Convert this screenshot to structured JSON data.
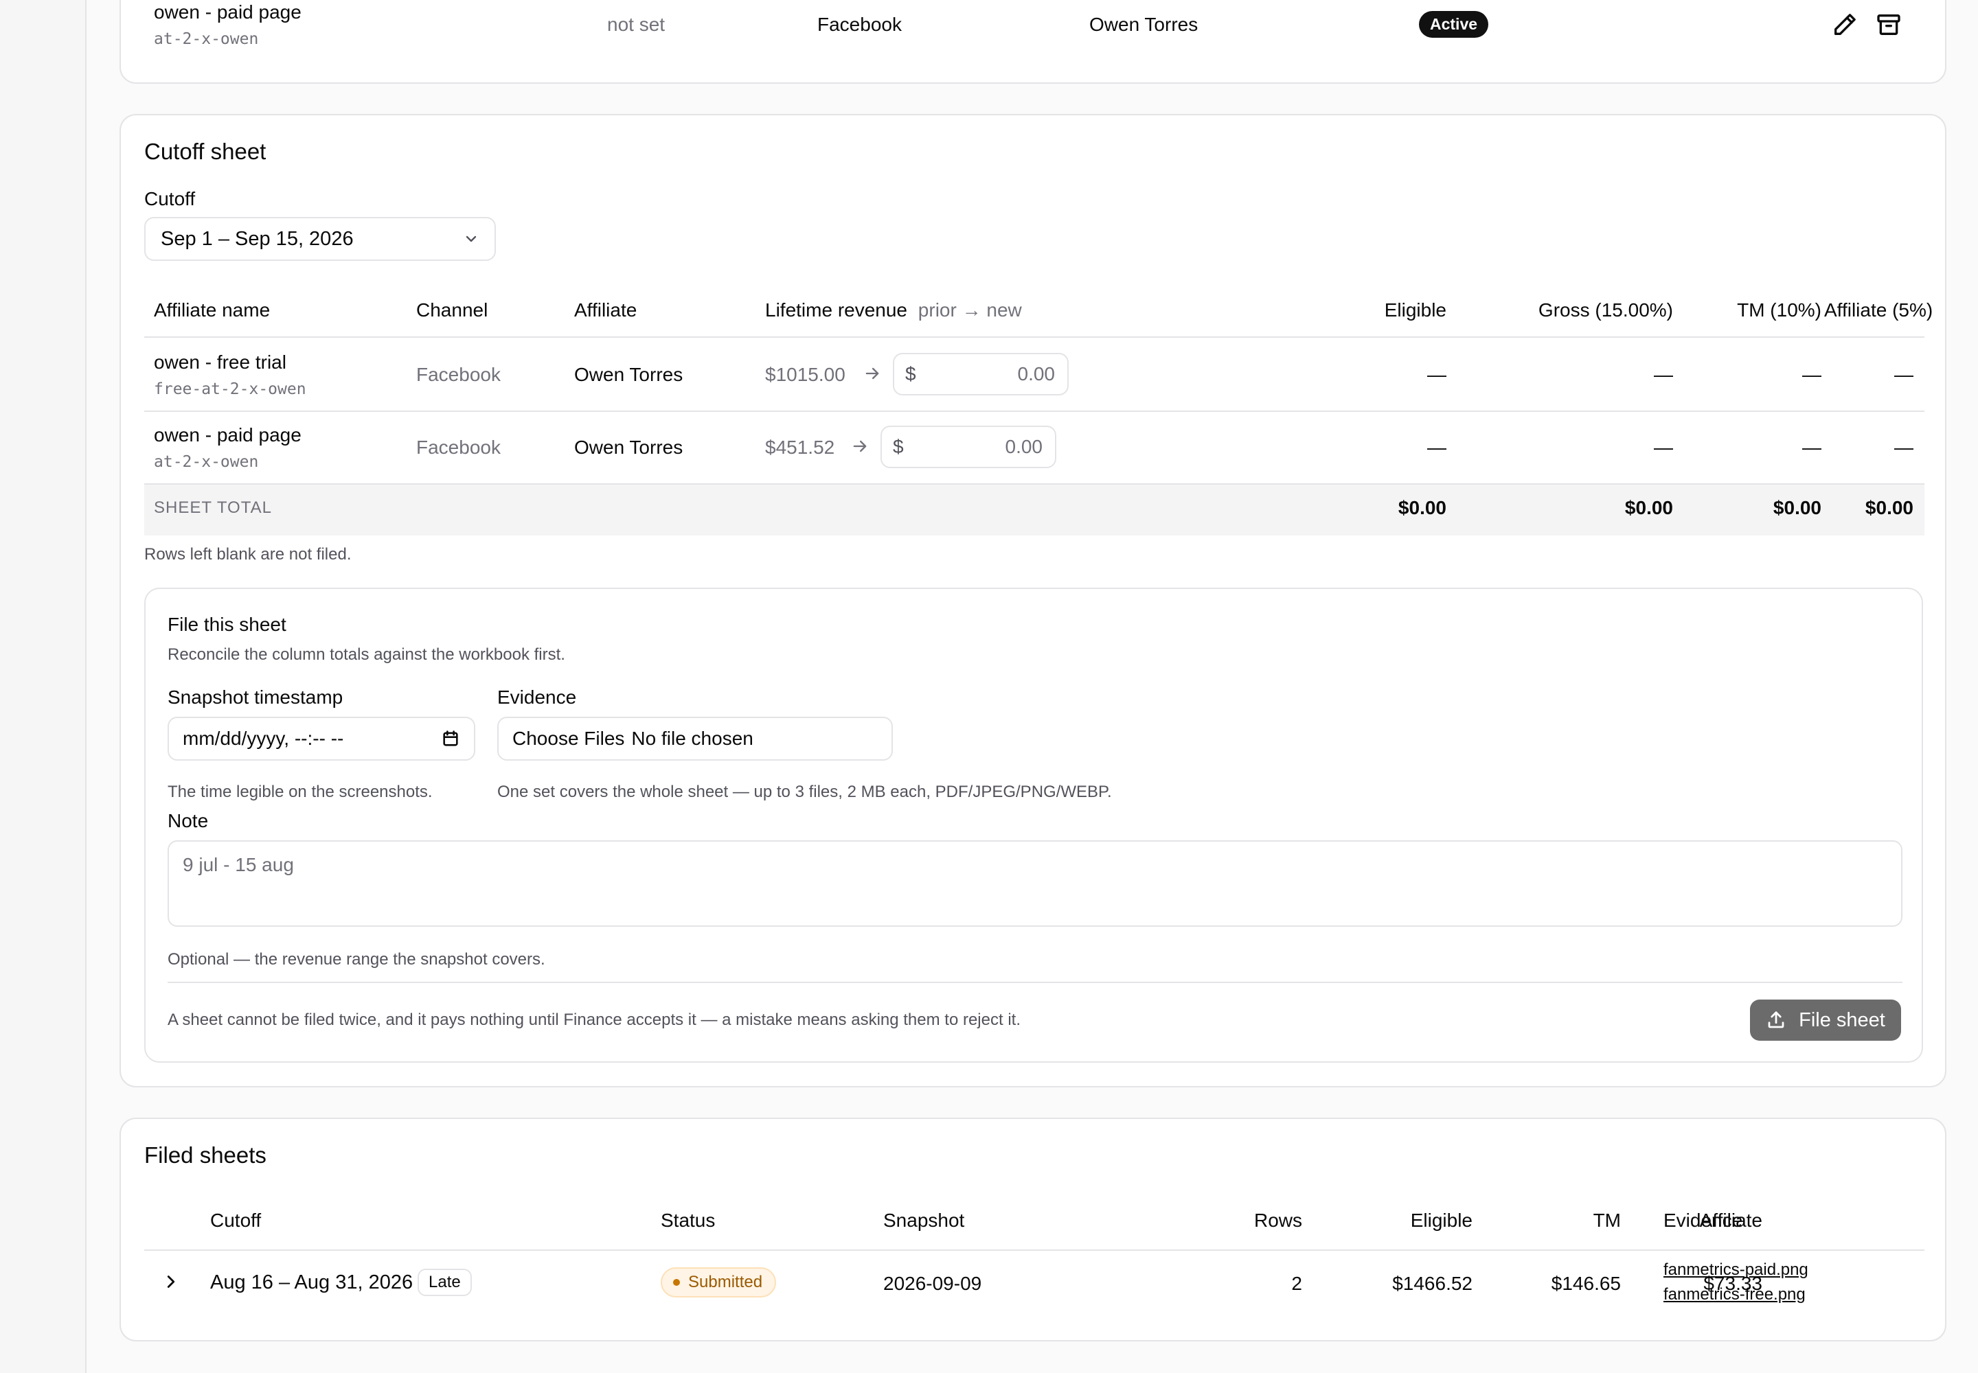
{
  "top_row": {
    "name": "owen - paid page",
    "slug": "at-2-x-owen",
    "revenue_status": "not set",
    "channel": "Facebook",
    "affiliate": "Owen Torres",
    "status": "Active"
  },
  "cutoff_sheet": {
    "title": "Cutoff sheet",
    "cutoff_label": "Cutoff",
    "cutoff_value": "Sep 1 – Sep 15, 2026",
    "columns": {
      "affiliate_name": "Affiliate name",
      "channel": "Channel",
      "affiliate": "Affiliate",
      "lifetime_revenue": "Lifetime revenue",
      "prior_new": "prior → new",
      "eligible": "Eligible",
      "gross": "Gross (15.00%)",
      "tm": "TM (10%)",
      "affiliate_pct": "Affiliate (5%)"
    },
    "rows": [
      {
        "name": "owen - free trial",
        "slug": "free-at-2-x-owen",
        "channel": "Facebook",
        "affiliate": "Owen Torres",
        "prior": "$1015.00",
        "currency": "$",
        "new_placeholder": "0.00",
        "eligible": "—",
        "gross": "—",
        "tm": "—",
        "affiliate_amt": "—"
      },
      {
        "name": "owen - paid page",
        "slug": "at-2-x-owen",
        "channel": "Facebook",
        "affiliate": "Owen Torres",
        "prior": "$451.52",
        "currency": "$",
        "new_placeholder": "0.00",
        "eligible": "—",
        "gross": "—",
        "tm": "—",
        "affiliate_amt": "—"
      }
    ],
    "total": {
      "label": "SHEET TOTAL",
      "eligible": "$0.00",
      "gross": "$0.00",
      "tm": "$0.00",
      "affiliate": "$0.00"
    },
    "blank_note": "Rows left blank are not filed.",
    "file_form": {
      "title": "File this sheet",
      "subtitle": "Reconcile the column totals against the workbook first.",
      "snapshot_label": "Snapshot timestamp",
      "snapshot_placeholder": "mm/dd/yyyy, --:-- --",
      "snapshot_help": "The time legible on the screenshots.",
      "evidence_label": "Evidence",
      "choose_files": "Choose Files",
      "no_file": "No file chosen",
      "evidence_help": "One set covers the whole sheet — up to 3 files, 2 MB each, PDF/JPEG/PNG/WEBP.",
      "note_label": "Note",
      "note_placeholder": "9 jul - 15 aug",
      "note_help": "Optional — the revenue range the snapshot covers.",
      "warning": "A sheet cannot be filed twice, and it pays nothing until Finance accepts it — a mistake means asking them to reject it.",
      "submit": "File sheet"
    }
  },
  "filed_sheets": {
    "title": "Filed sheets",
    "columns": {
      "cutoff": "Cutoff",
      "status": "Status",
      "snapshot": "Snapshot",
      "rows": "Rows",
      "eligible": "Eligible",
      "tm": "TM",
      "affiliate": "Affiliate",
      "evidence": "Evidence"
    },
    "rows": [
      {
        "cutoff": "Aug 16 – Aug 31, 2026",
        "late": "Late",
        "status": "Submitted",
        "snapshot": "2026-09-09",
        "rows": "2",
        "eligible": "$1466.52",
        "tm": "$146.65",
        "affiliate": "$73.33",
        "evidence": [
          "fanmetrics-paid.png",
          "fanmetrics-free.png"
        ]
      }
    ]
  },
  "colors": {
    "background": "#fafafa",
    "card": "#ffffff",
    "border": "#e4e4e7",
    "muted_text": "#71717a",
    "badge_active": "#111111",
    "status_submitted_bg": "#fff4e5",
    "status_submitted_text": "#9a5a00",
    "button_disabled": "#6b6b6b"
  },
  "icons": [
    "pencil-icon",
    "archive-icon",
    "chevron-down-icon",
    "arrow-right-icon",
    "calendar-icon",
    "upload-icon",
    "chevron-right-icon"
  ]
}
